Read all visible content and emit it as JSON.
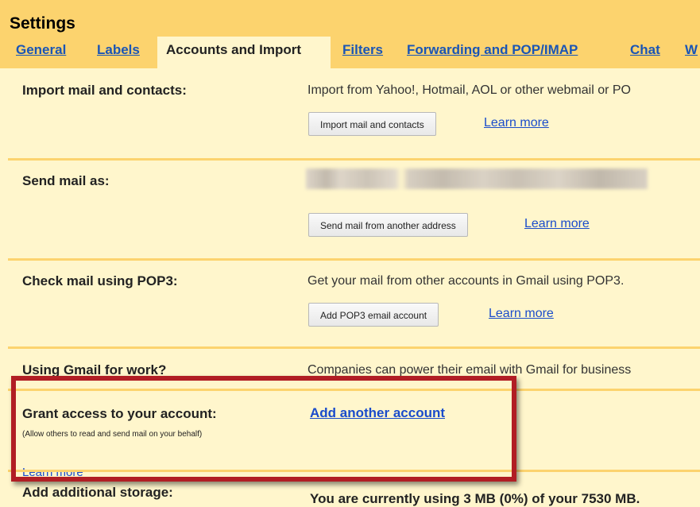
{
  "header": {
    "title": "Settings",
    "tabs": [
      "General",
      "Labels",
      "Accounts and Import",
      "Filters",
      "Forwarding and POP/IMAP",
      "Chat",
      "W"
    ],
    "active_tab_index": 2
  },
  "sections": {
    "import": {
      "label": "Import mail and contacts:",
      "description": "Import from Yahoo!, Hotmail, AOL or other webmail or PO",
      "button": "Import mail and contacts",
      "link": "Learn more"
    },
    "send_as": {
      "label": "Send mail as:",
      "button": "Send mail from another address",
      "link": "Learn more"
    },
    "pop3": {
      "label": "Check mail using POP3:",
      "description": "Get your mail from other accounts in Gmail using POP3.",
      "button": "Add POP3 email account",
      "link": "Learn more"
    },
    "work": {
      "label": "Using Gmail for work?",
      "description": "Companies can power their email with Gmail for business"
    },
    "grant": {
      "label": "Grant access to your account:",
      "note": "(Allow others to read and send mail on your behalf)",
      "learn_more": "Learn more",
      "action_link": "Add another account"
    },
    "storage": {
      "label": "Add additional storage:",
      "description": "You are currently using 3 MB (0%) of your 7530 MB."
    }
  },
  "colors": {
    "header_bg": "#fcd36e",
    "panel_bg": "#fff6cc",
    "link": "#1a4ccb",
    "highlight_border": "#b11e24"
  }
}
